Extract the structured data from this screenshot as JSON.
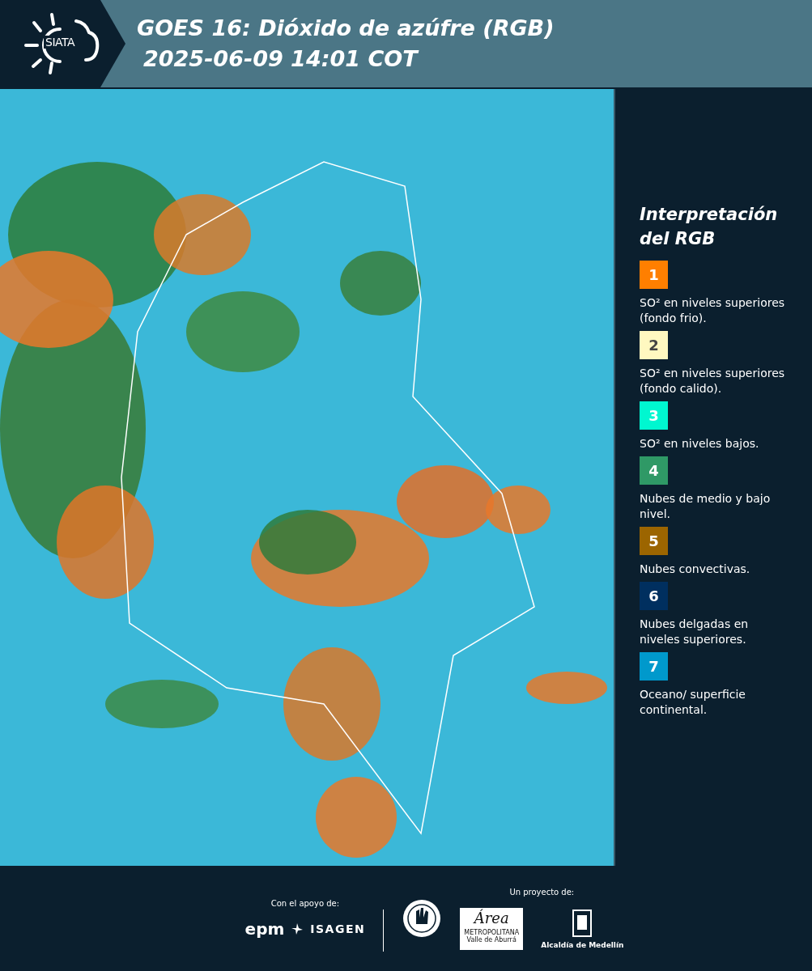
{
  "header": {
    "logo": "SIATA",
    "title": "GOES 16: Dióxido de azúfre (RGB)",
    "subtitle": "2025-06-09 14:01 COT"
  },
  "legend": {
    "title_line_1": "Interpretación",
    "title_line_2": "del RGB",
    "items": [
      {
        "number": "1",
        "color": "#ff7f00",
        "text": "SO² en niveles superiores (fondo frio)."
      },
      {
        "number": "2",
        "color": "#fff8c0",
        "text": "SO² en niveles superiores (fondo calido)."
      },
      {
        "number": "3",
        "color": "#00f7d0",
        "text": "SO² en niveles bajos."
      },
      {
        "number": "4",
        "color": "#2f9966",
        "text": "Nubes de medio y bajo nivel."
      },
      {
        "number": "5",
        "color": "#9c6500",
        "text": "Nubes convectivas."
      },
      {
        "number": "6",
        "color": "#002f5f",
        "text": "Nubes delgadas en niveles superiores."
      },
      {
        "number": "7",
        "color": "#0099cc",
        "text": "Oceano/ superficie continental."
      }
    ]
  },
  "footer": {
    "support_label": "Con el apoyo de:",
    "project_label": "Un proyecto de:",
    "epm": "epm",
    "isagen": "ISAGEN",
    "area": "Área",
    "area_line_1": "METROPOLITANA",
    "area_line_2": "Valle de Aburrá",
    "alcaldia": "Alcaldía de Medellín"
  }
}
